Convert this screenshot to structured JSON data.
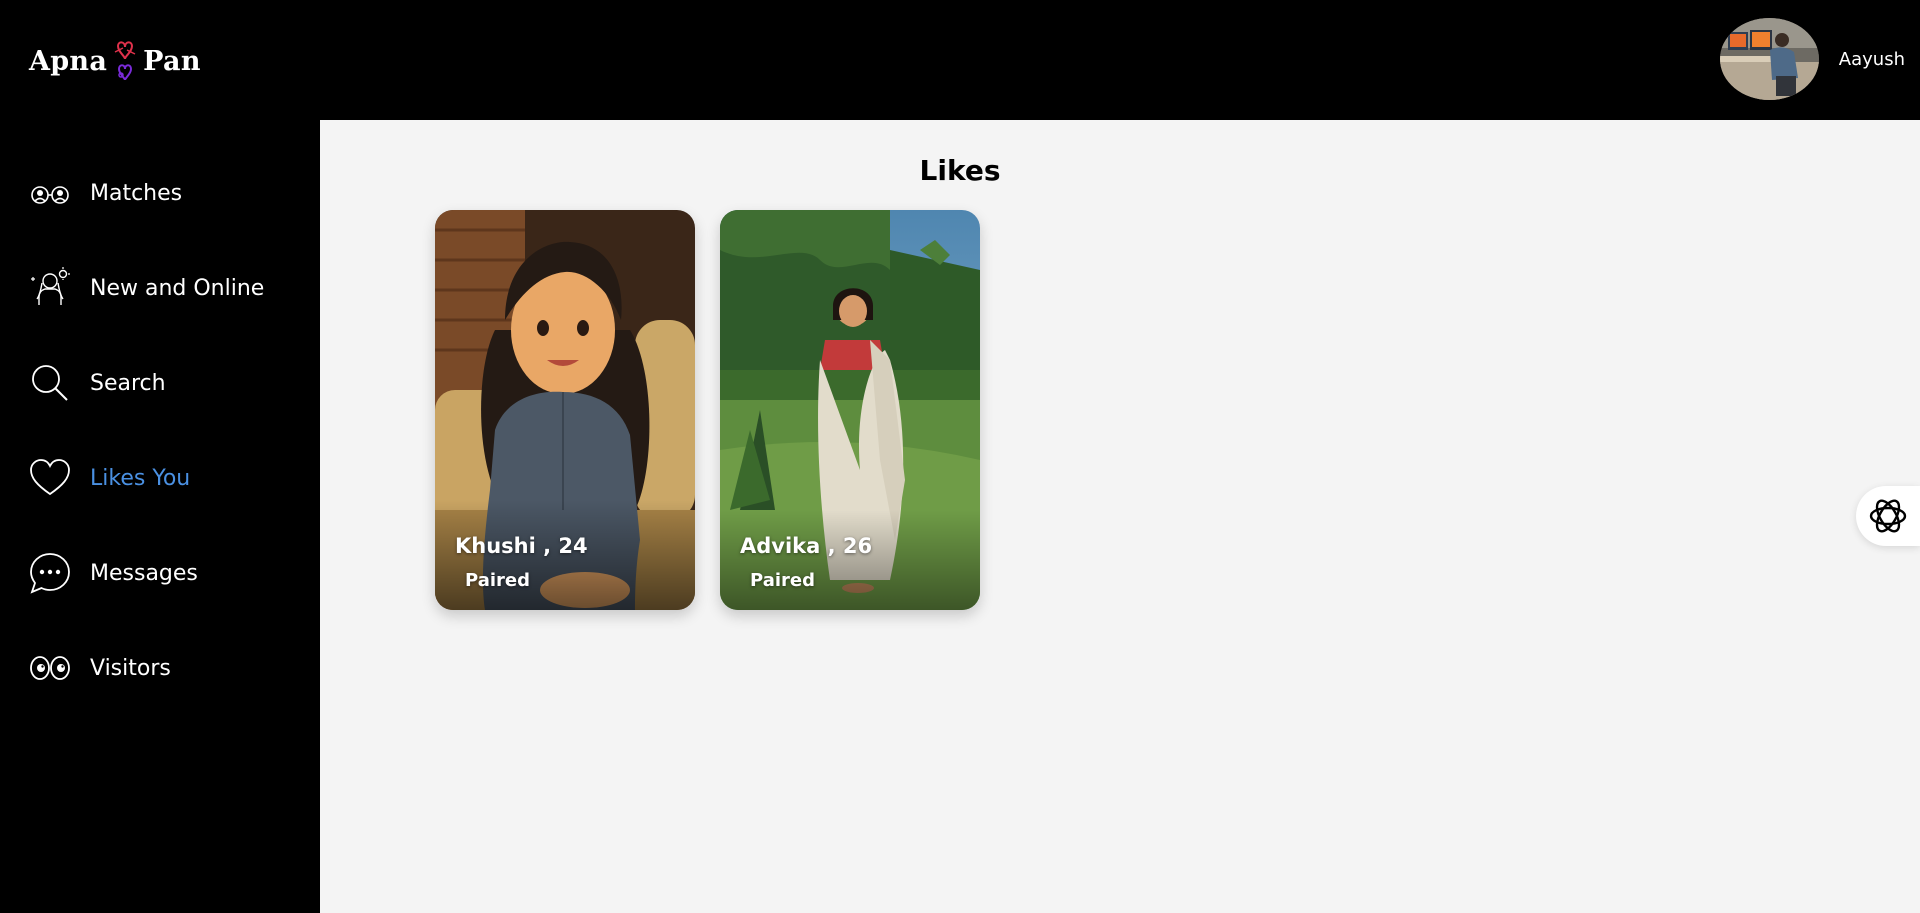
{
  "app": {
    "logo_left": "Apna",
    "logo_right": "Pan",
    "accent_color": "#4a90e2"
  },
  "user": {
    "name": "Aayush"
  },
  "sidebar": {
    "items": [
      {
        "label": "Matches",
        "icon": "matches-icon"
      },
      {
        "label": "New and Online",
        "icon": "new-online-icon"
      },
      {
        "label": "Search",
        "icon": "search-icon"
      },
      {
        "label": "Likes You",
        "icon": "heart-icon",
        "active": true
      },
      {
        "label": "Messages",
        "icon": "chat-bubble-icon"
      },
      {
        "label": "Visitors",
        "icon": "eyes-icon"
      }
    ]
  },
  "main": {
    "title": "Likes",
    "cards": [
      {
        "name": "Khushi",
        "age": "24",
        "display": "Khushi ,  24",
        "status": "Paired"
      },
      {
        "name": "Advika",
        "age": "26",
        "display": "Advika , 26",
        "status": "Paired"
      }
    ]
  },
  "assistant": {
    "icon": "openai-icon"
  }
}
